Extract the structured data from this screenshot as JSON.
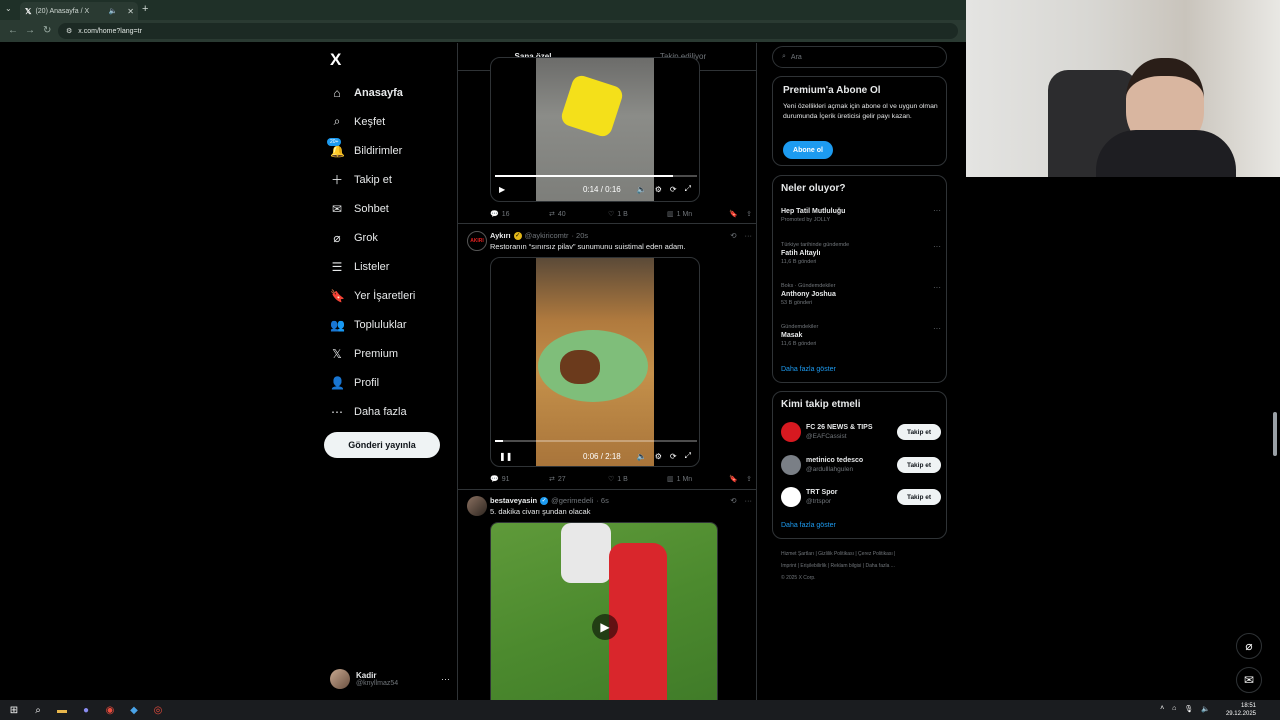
{
  "browser": {
    "tab_title": "(20) Anasayfa / X",
    "url": "x.com/home?lang=tr"
  },
  "nav": {
    "logo": "X",
    "items": [
      {
        "label": "Anasayfa",
        "icon": "home-icon"
      },
      {
        "label": "Keşfet",
        "icon": "search-icon"
      },
      {
        "label": "Bildirimler",
        "icon": "bell-icon",
        "badge": "20+"
      },
      {
        "label": "Takip et",
        "icon": "follow-icon"
      },
      {
        "label": "Sohbet",
        "icon": "mail-icon"
      },
      {
        "label": "Grok",
        "icon": "grok-icon"
      },
      {
        "label": "Listeler",
        "icon": "list-icon"
      },
      {
        "label": "Yer İşaretleri",
        "icon": "bookmark-icon"
      },
      {
        "label": "Topluluklar",
        "icon": "communities-icon"
      },
      {
        "label": "Premium",
        "icon": "x-icon"
      },
      {
        "label": "Profil",
        "icon": "profile-icon"
      },
      {
        "label": "Daha fazla",
        "icon": "more-icon"
      }
    ],
    "post_button": "Gönderi yayınla",
    "account": {
      "name": "Kadir",
      "handle": "@knyllmaz54"
    }
  },
  "feed": {
    "tabs": [
      "Sana özel",
      "Takip ediliyor"
    ],
    "post1": {
      "video_time": "0:14 / 0:16",
      "progress": 0.88,
      "stats": {
        "replies": "16",
        "reposts": "40",
        "likes": "1 B",
        "views": "1 Mn"
      }
    },
    "post2": {
      "name": "Aykırı",
      "handle": "@aykiricomtr",
      "time": "· 20s",
      "text": "Restoranın “sınırsız pilav” sunumunu suistimal eden adam.",
      "video_time": "0:06 / 2:18",
      "progress": 0.04,
      "stats": {
        "replies": "91",
        "reposts": "27",
        "likes": "1 B",
        "views": "1 Mn"
      }
    },
    "post3": {
      "name": "bestaveyasin",
      "handle": "@gerimedeli",
      "time": "· 6s",
      "text": "5. dakika civarı şundan olacak"
    }
  },
  "right": {
    "search_placeholder": "Ara",
    "premium": {
      "title": "Premium'a Abone Ol",
      "text": "Yeni özellikleri açmak için abone ol ve uygun olman durumunda İçerik üreticisi gelir payı kazan.",
      "button": "Abone ol"
    },
    "trends": {
      "title": "Neler oluyor?",
      "items": [
        {
          "meta": "",
          "title": "Hep Tatil Mutluluğu",
          "count": "Promoted by JOLLY"
        },
        {
          "meta": "Türkiye tarihinde gündemde",
          "title": "Fatih Altaylı",
          "count": "11,6 B gönderi"
        },
        {
          "meta": "Boks · Gündemdekiler",
          "title": "Anthony Joshua",
          "count": "53 B gönderi"
        },
        {
          "meta": "Gündemdekiler",
          "title": "Masak",
          "count": "11,6 B gönderi"
        }
      ],
      "show_more": "Daha fazla göster"
    },
    "who_to_follow": {
      "title": "Kimi takip etmeli",
      "items": [
        {
          "name": "FC 26 NEWS & TIPS",
          "handle": "@EAFCassist",
          "button": "Takip et",
          "avatar_color": "#d71920"
        },
        {
          "name": "metinico tedesco",
          "handle": "@ardulllahgulen",
          "button": "Takip et",
          "avatar_color": "#7a7f86"
        },
        {
          "name": "TRT Spor",
          "handle": "@trtspor",
          "button": "Takip et",
          "avatar_color": "#ffffff"
        }
      ],
      "show_more": "Daha fazla göster"
    },
    "footer": {
      "line1": "Hizmet Şartları | Gizlilik Politikası | Çerez Politikası |",
      "line2": "Imprint | Erişilebilirlik | Reklam bilgisi | Daha fazla ...",
      "line3": "© 2025 X Corp."
    }
  },
  "taskbar": {
    "time": "18:51",
    "date": "29.12.2025"
  }
}
